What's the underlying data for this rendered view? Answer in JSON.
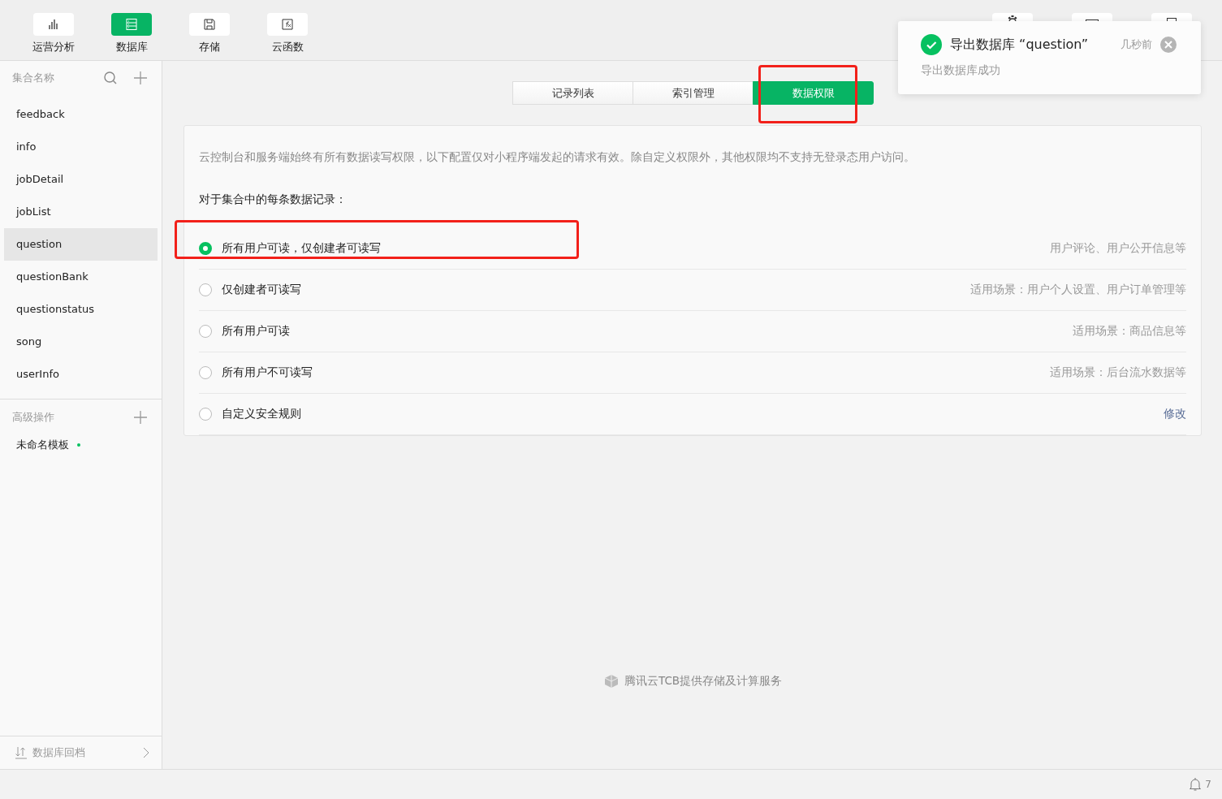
{
  "toolbar": {
    "items": [
      {
        "label": "运营分析",
        "selected": false
      },
      {
        "label": "数据库",
        "selected": true
      },
      {
        "label": "存储",
        "selected": false
      },
      {
        "label": "云函数",
        "selected": false
      }
    ]
  },
  "sidebar": {
    "collections_header": "集合名称",
    "collections": [
      {
        "name": "feedback",
        "selected": false
      },
      {
        "name": "info",
        "selected": false
      },
      {
        "name": "jobDetail",
        "selected": false
      },
      {
        "name": "jobList",
        "selected": false
      },
      {
        "name": "question",
        "selected": true
      },
      {
        "name": "questionBank",
        "selected": false
      },
      {
        "name": "questionstatus",
        "selected": false
      },
      {
        "name": "song",
        "selected": false
      },
      {
        "name": "userInfo",
        "selected": false
      }
    ],
    "advanced_header": "高级操作",
    "templates": [
      {
        "name": "未命名模板",
        "color": "#07c160"
      }
    ],
    "footer": "数据库回档"
  },
  "tabs": [
    {
      "label": "记录列表",
      "selected": false
    },
    {
      "label": "索引管理",
      "selected": false
    },
    {
      "label": "数据权限",
      "selected": true
    }
  ],
  "panel": {
    "notice": "云控制台和服务端始终有所有数据读写权限，以下配置仅对小程序端发起的请求有效。除自定义权限外，其他权限均不支持无登录态用户访问。",
    "prompt": "对于集合中的每条数据记录：",
    "options": [
      {
        "label": "所有用户可读，仅创建者可读写",
        "hint": "用户评论、用户公开信息等",
        "kind": "hint",
        "selected": true
      },
      {
        "label": "仅创建者可读写",
        "hint": "适用场景：用户个人设置、用户订单管理等",
        "kind": "hint",
        "selected": false
      },
      {
        "label": "所有用户可读",
        "hint": "适用场景：商品信息等",
        "kind": "hint",
        "selected": false
      },
      {
        "label": "所有用户不可读写",
        "hint": "适用场景：后台流水数据等",
        "kind": "hint",
        "selected": false
      },
      {
        "label": "自定义安全规则",
        "hint": "修改",
        "kind": "link",
        "selected": false
      }
    ]
  },
  "footer_credit": "腾讯云TCB提供存储及计算服务",
  "toast": {
    "title": "导出数据库 “question”",
    "time": "几秒前",
    "message": "导出数据库成功"
  },
  "status_bar": {
    "notifications": "7"
  }
}
